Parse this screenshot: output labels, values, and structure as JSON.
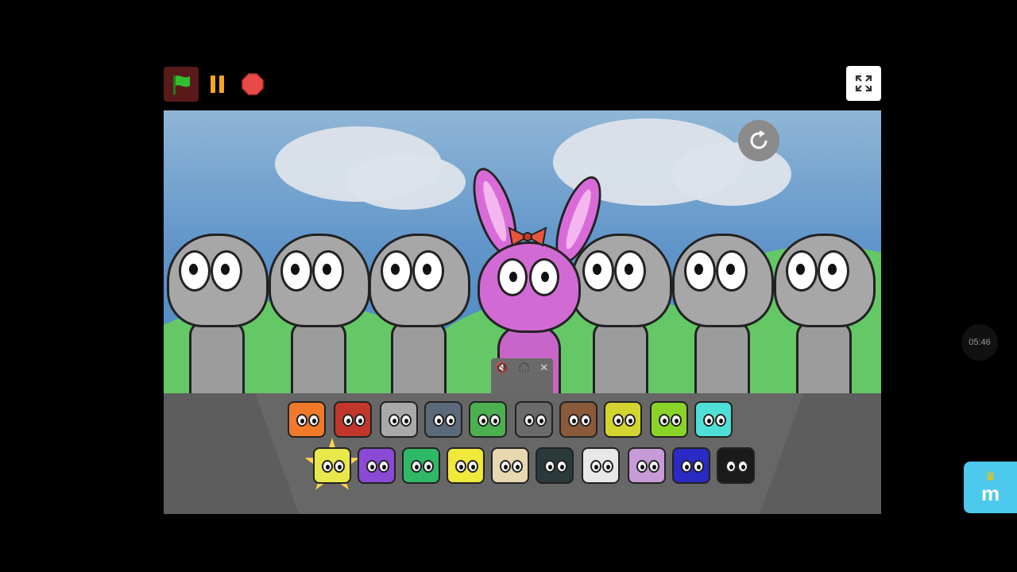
{
  "controls": {
    "green_flag": "green-flag-icon",
    "pause": "pause-icon",
    "stop": "stop-icon",
    "fullscreen": "fullscreen-icon"
  },
  "stage": {
    "refresh": "refresh-icon",
    "audio_bar": [
      "mute-icon",
      "headphones-icon",
      "close-icon"
    ]
  },
  "palette": {
    "row1": [
      "orange",
      "red",
      "gray-bucket",
      "robot",
      "green-flower",
      "gray-cat",
      "brown-bucket",
      "yellow-speakers",
      "lime-spiky",
      "cyan-bear"
    ],
    "row2": [
      "yellow-star",
      "purple-spiky",
      "green-pink",
      "yellow-bumps",
      "cowboy",
      "sprout",
      "white-cat",
      "pink-bunny",
      "blue-blob",
      "black-tophat"
    ],
    "selected": "yellow-star"
  },
  "overlay": {
    "timer": "05:46",
    "side_tab_label": "m"
  },
  "colors": {
    "flag_bg": "#5a1a1a",
    "flag": "#2fbf2f",
    "pause": "#f5a623",
    "stop": "#e84a4a",
    "side_tab": "#4ec9ee"
  }
}
